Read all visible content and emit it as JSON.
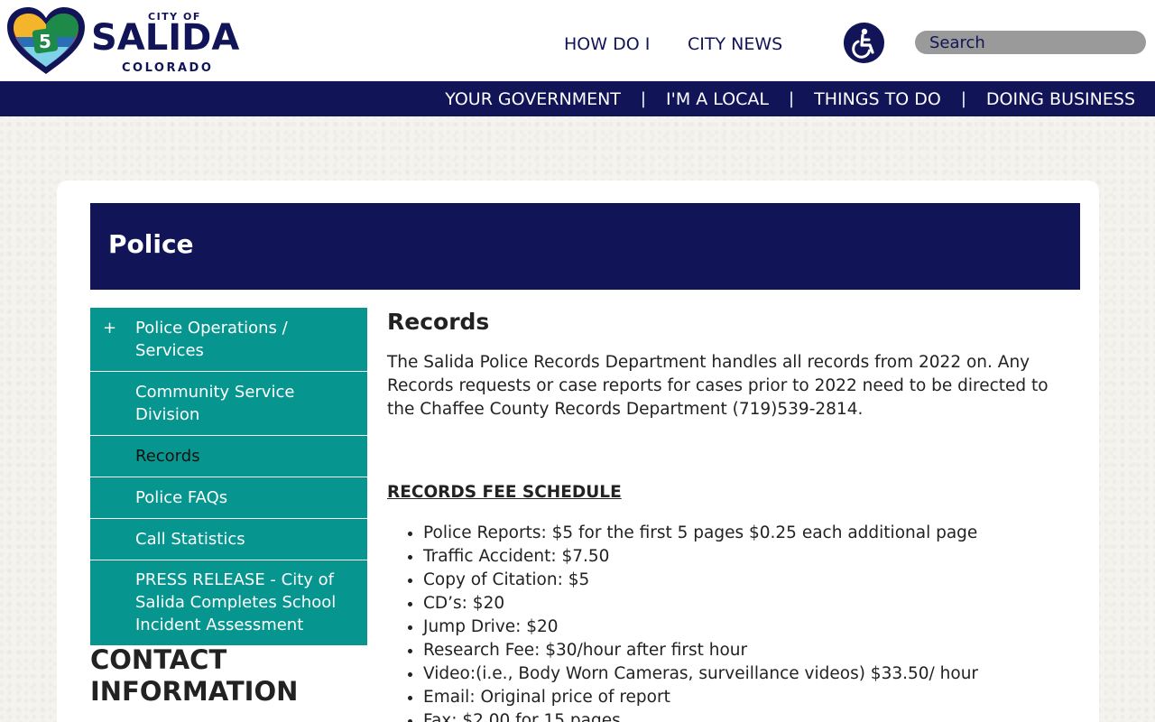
{
  "header": {
    "logo": {
      "top_text": "CITY OF",
      "main_text": "SALIDA",
      "bottom_text": "COLORADO",
      "badge": "5"
    },
    "top_nav": {
      "how_do_i": "HOW DO I",
      "city_news": "CITY NEWS"
    },
    "accessibility_icon": "wheelchair-icon",
    "search": {
      "placeholder": "Search",
      "value": ""
    }
  },
  "main_nav": {
    "items": [
      "YOUR GOVERNMENT",
      "I'M A LOCAL",
      "THINGS TO DO",
      "DOING BUSINESS"
    ],
    "separator": "|"
  },
  "page": {
    "title": "Police"
  },
  "side_nav": {
    "expand_symbol": "+",
    "items": [
      "Police Operations / Services",
      "Community Service Division",
      "Records",
      "Police FAQs",
      "Call Statistics",
      "PRESS RELEASE - City of Salida Completes School Incident Assessment"
    ],
    "active_index": 2
  },
  "contact": {
    "title": "CONTACT INFORMATION"
  },
  "content": {
    "heading": "Records",
    "intro": "The Salida Police Records Department handles all records from 2022 on. Any Records requests or case reports for cases prior to 2022 need to be directed to the Chaffee County Records Department (719)539-2814.",
    "fee_heading": "RECORDS FEE SCHEDULE",
    "fees": [
      "Police Reports: $5 for the first 5 pages $0.25 each additional page",
      "Traffic Accident: $7.50",
      "Copy of Citation: $5",
      "CD’s: $20",
      "Jump Drive: $20",
      "Research Fee: $30/hour after first hour",
      "Video:(i.e., Body Worn Cameras, surveillance videos) $33.50/ hour",
      "Email: Original price of report",
      "Fax: $2.00 for 15 pages"
    ]
  },
  "colors": {
    "navy": "#121458",
    "teal": "#07958f",
    "search_bg": "#9a9a9a",
    "logo_red": "#e23b3b",
    "logo_yellow": "#f4b52a",
    "logo_green": "#1d8a4a",
    "logo_blue": "#2a6fb5"
  }
}
